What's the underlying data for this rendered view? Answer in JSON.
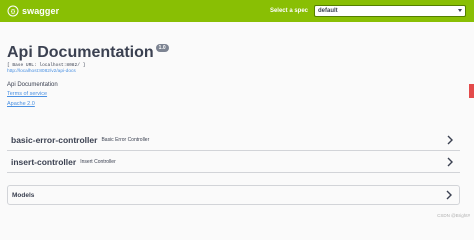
{
  "topbar": {
    "logo_text": "swagger",
    "spec_label": "Select a spec",
    "spec_value": "default",
    "colors": {
      "background": "#89bf04",
      "text": "#ffffff"
    }
  },
  "info": {
    "title": "Api Documentation",
    "version": "1.0",
    "base_url": "[ Base URL: localhost:8082/ ]",
    "docs_link": "http://localhost:8082/v2/api-docs",
    "description": "Api Documentation",
    "terms_link": "Terms of service",
    "license_link": "Apache 2.0"
  },
  "controllers": [
    {
      "name": "basic-error-controller",
      "description": "Basic Error Controller"
    },
    {
      "name": "insert-controller",
      "description": "Insert Controller"
    }
  ],
  "models": {
    "label": "Models"
  },
  "watermark": "CSDN @Bright#",
  "colors": {
    "link": "#4990e2",
    "text": "#3b4151",
    "badge": "#7d8492",
    "scrollbar": "#e34b4b"
  }
}
